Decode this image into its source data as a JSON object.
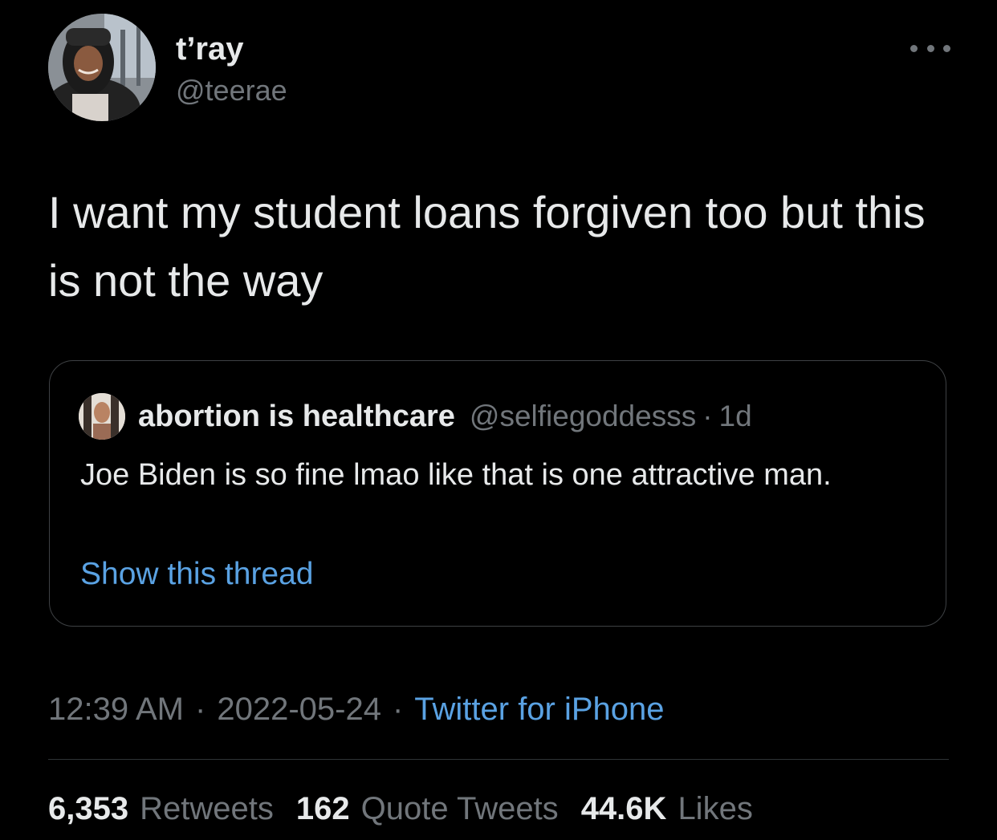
{
  "author": {
    "name": "t’ray",
    "handle": "@teerae",
    "avatar_icon": "user-avatar"
  },
  "tweet": {
    "text": "I want my student loans forgiven too but this is not the way"
  },
  "quoted_tweet": {
    "name": "abortion is healthcare",
    "handle": "@selfiegoddesss",
    "separator": "·",
    "time": "1d",
    "text": "Joe Biden is so fine lmao like that is one attractive man.",
    "show_thread": "Show this thread",
    "avatar_icon": "user-avatar"
  },
  "meta": {
    "time": "12:39 AM",
    "separator": "·",
    "date": "2022-05-24",
    "source": "Twitter for iPhone"
  },
  "stats": {
    "retweets_count": "6,353",
    "retweets_label": "Retweets",
    "quotes_count": "162",
    "quotes_label": "Quote Tweets",
    "likes_count": "44.6K",
    "likes_label": "Likes"
  },
  "colors": {
    "background": "#000000",
    "text_primary": "#e7e9ea",
    "text_secondary": "#71767b",
    "link": "#5aa2e3",
    "border": "#3e4144"
  },
  "icons": {
    "more_options": "more-horizontal-icon"
  }
}
